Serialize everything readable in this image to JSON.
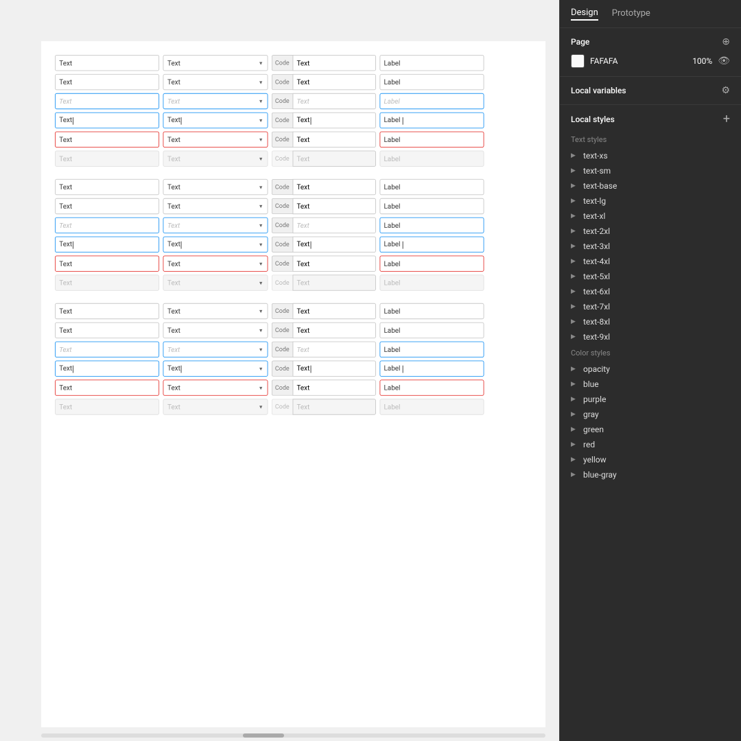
{
  "tabs": {
    "design": "Design",
    "prototype": "Prototype"
  },
  "page": {
    "title": "Page",
    "color_hex": "FAFAFA",
    "opacity": "100%"
  },
  "local_variables": {
    "title": "Local variables"
  },
  "local_styles": {
    "title": "Local styles",
    "text_styles_label": "Text styles",
    "text_styles": [
      "text-xs",
      "text-sm",
      "text-base",
      "text-lg",
      "text-xl",
      "text-2xl",
      "text-3xl",
      "text-4xl",
      "text-5xl",
      "text-6xl",
      "text-7xl",
      "text-8xl",
      "text-9xl"
    ],
    "color_styles_label": "Color styles",
    "color_styles": [
      {
        "name": "opacity",
        "color": "#aaaaaa"
      },
      {
        "name": "blue",
        "color": "#2196f3"
      },
      {
        "name": "purple",
        "color": "#9c27b0"
      },
      {
        "name": "gray",
        "color": "#9e9e9e"
      },
      {
        "name": "green",
        "color": "#4caf50"
      },
      {
        "name": "red",
        "color": "#f44336"
      },
      {
        "name": "yellow",
        "color": "#ffeb3b"
      },
      {
        "name": "blue-gray",
        "color": "#607d8b"
      }
    ]
  },
  "canvas": {
    "inputs": {
      "text_label": "Text",
      "code_label": "Code",
      "label_label": "Label",
      "placeholder": "Text",
      "placeholder_label": "Label",
      "typing_text": "Text|",
      "error_text": "Text"
    }
  }
}
